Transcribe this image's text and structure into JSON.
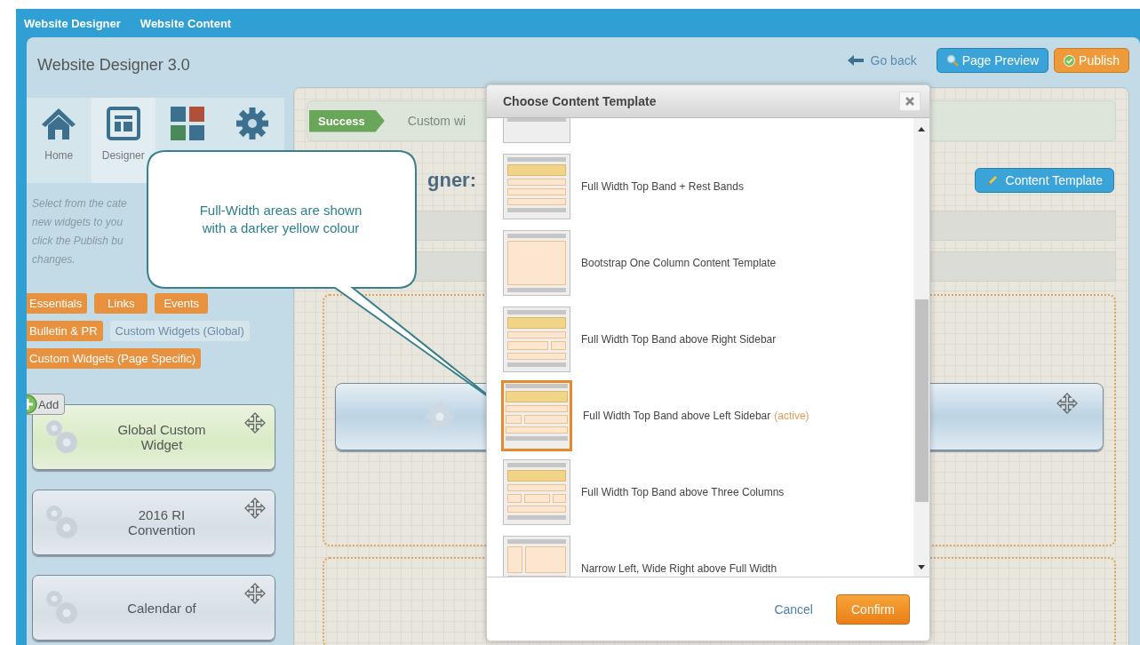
{
  "top_tabs": [
    {
      "label": "Website Designer"
    },
    {
      "label": "Website Content"
    }
  ],
  "window": {
    "title": "Website Designer 3.0"
  },
  "header_actions": {
    "back": "Go back",
    "preview": "Page Preview",
    "publish": "Publish"
  },
  "nav": [
    {
      "kind": "home",
      "label": "Home",
      "selected": false
    },
    {
      "kind": "designer",
      "label": "Designer",
      "selected": true
    },
    {
      "kind": "widgets",
      "selected": false
    },
    {
      "kind": "settings",
      "selected": false
    }
  ],
  "description_lines": [
    "Select from the cate",
    "new widgets to you",
    "click the Publish bu",
    "changes."
  ],
  "categories": [
    {
      "label": "Essentials",
      "selected": false
    },
    {
      "label": "Links",
      "selected": false
    },
    {
      "label": "Events",
      "selected": false
    },
    {
      "label": "Bulletin & PR",
      "selected": false
    },
    {
      "label": "Custom Widgets (Global)",
      "selected": true
    },
    {
      "label": "Custom Widgets (Page Specific)",
      "selected": false
    }
  ],
  "widgets": [
    {
      "title": "Global Custom Widget",
      "kind": "global",
      "add_label": "Add"
    },
    {
      "title": "2016 RI Convention",
      "kind": "page"
    },
    {
      "title": "Calendar of",
      "kind": "page"
    }
  ],
  "status": {
    "badge": "Success",
    "message": "Custom wi"
  },
  "page_heading": "gner:",
  "content_template_button": "Content Template",
  "dialog": {
    "title": "Choose Content Template",
    "cancel": "Cancel",
    "confirm": "Confirm",
    "templates": [
      {
        "kind": "three-col",
        "selected": false
      },
      {
        "kind": "top-band-rest",
        "name": "Full Width Top Band + Rest Bands",
        "selected": false
      },
      {
        "kind": "one-col",
        "name": "Bootstrap One Column Content Template",
        "selected": false
      },
      {
        "kind": "top-band-right",
        "name": "Full Width Top Band above Right Sidebar",
        "selected": false
      },
      {
        "kind": "top-band-left",
        "name": "Full Width Top Band above Left Sidebar",
        "active_label": "(active)",
        "selected": true
      },
      {
        "kind": "top-band-three",
        "name": "Full Width Top Band above Three Columns",
        "selected": false
      },
      {
        "kind": "narrow-left",
        "name": "Narrow Left, Wide Right above Full Width",
        "selected": false
      }
    ]
  },
  "callout": {
    "text": "Full-Width areas are shown with a darker yellow colour"
  }
}
